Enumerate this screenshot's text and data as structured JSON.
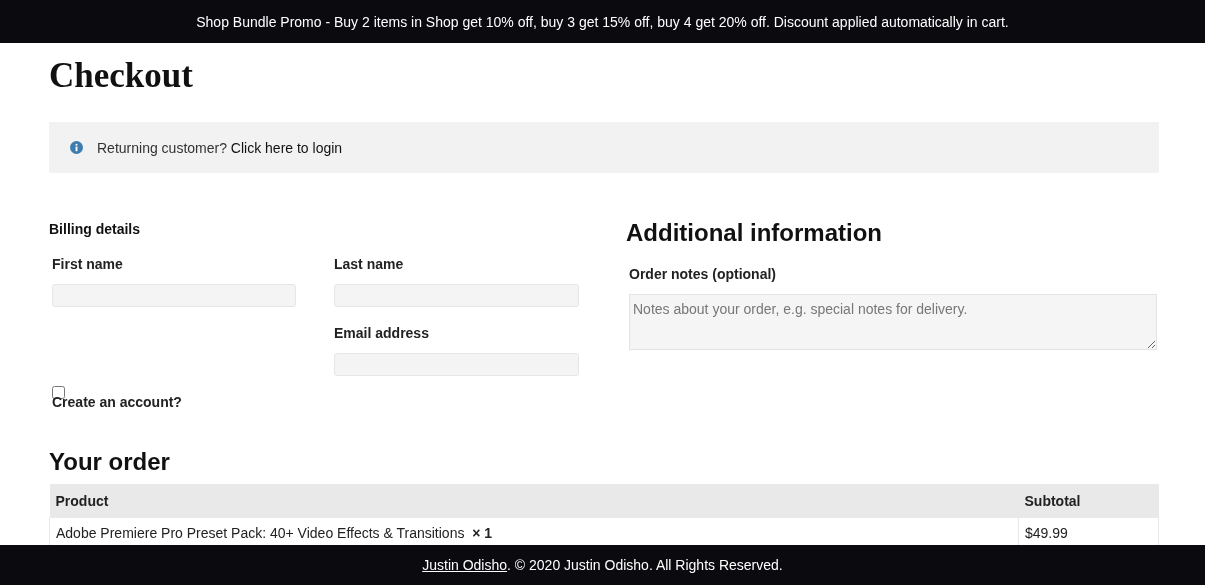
{
  "promo_bar": {
    "text": "Shop Bundle Promo - Buy 2 items in Shop get 10% off, buy 3 get 15% off, buy 4 get 20% off. Discount applied automatically in cart."
  },
  "page_title": "Checkout",
  "notice": {
    "text": "Returning customer?",
    "link": "Click here to login"
  },
  "billing": {
    "title": "Billing details",
    "fields": [
      {
        "label": "First name"
      },
      {
        "label": "Last name"
      },
      {
        "label": "Email address"
      }
    ],
    "create_account": {
      "label": "Create an account?",
      "checked": false
    }
  },
  "additional": {
    "title": "Additional information",
    "notes_label": "Order notes (optional)",
    "placeholder": "Notes about your order, e.g. special notes for delivery."
  },
  "order": {
    "title": "Your order",
    "columns": [
      "Product",
      "Subtotal"
    ],
    "rows": [
      {
        "product": "Adobe Premiere Pro Preset Pack: 40+ Video Effects & Transitions",
        "quantity": "× 1",
        "subtotal": "$49.99"
      }
    ]
  },
  "footer": {
    "link": "Justin Odisho",
    "text": ". © 2020 Justin Odisho. All Rights Reserved."
  }
}
